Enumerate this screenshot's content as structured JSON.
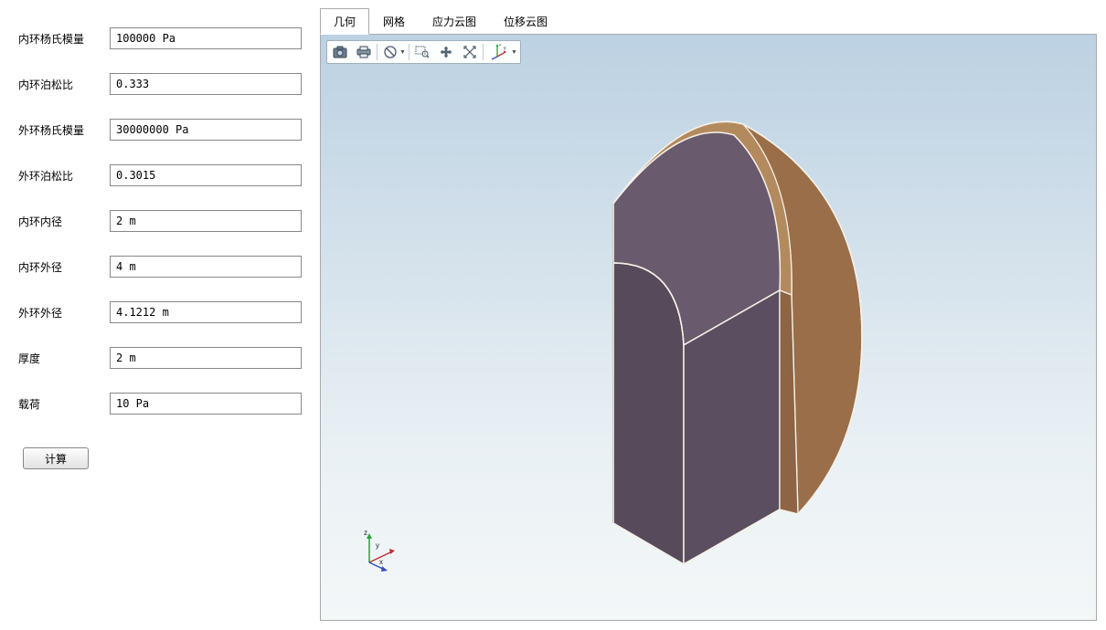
{
  "form": {
    "fields": [
      {
        "label": "内环杨氏模量",
        "value": "100000 Pa"
      },
      {
        "label": "内环泊松比",
        "value": "0.333"
      },
      {
        "label": "外环杨氏模量",
        "value": "30000000 Pa"
      },
      {
        "label": "外环泊松比",
        "value": "0.3015"
      },
      {
        "label": "内环内径",
        "value": "2 m"
      },
      {
        "label": "内环外径",
        "value": "4 m"
      },
      {
        "label": "外环外径",
        "value": "4.1212 m"
      },
      {
        "label": "厚度",
        "value": "2 m"
      },
      {
        "label": "载荷",
        "value": "10 Pa"
      }
    ],
    "calc_button": "计算"
  },
  "tabs": {
    "items": [
      "几何",
      "网格",
      "应力云图",
      "位移云图"
    ],
    "active_index": 0
  },
  "axes": {
    "x": "x",
    "y": "y",
    "z": "z"
  },
  "colors": {
    "geom_main": "#5e4f62",
    "geom_outer": "#a87b55",
    "geom_edge": "#f5f1e8"
  }
}
